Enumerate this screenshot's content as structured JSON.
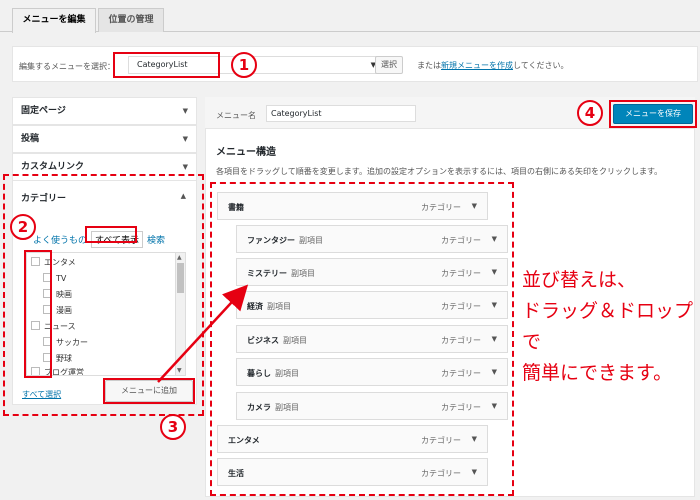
{
  "tabs": [
    {
      "label": "メニューを編集"
    },
    {
      "label": "位置の管理"
    }
  ],
  "manage": {
    "label": "編集するメニューを選択：",
    "selected_menu": "CategoryList",
    "select_button": "選択",
    "or_text": "または",
    "new_menu_link": "新規メニューを作成",
    "tail_text": "してください。"
  },
  "left": {
    "sections": [
      {
        "label": "固定ページ"
      },
      {
        "label": "投稿"
      },
      {
        "label": "カスタムリンク"
      }
    ],
    "category": {
      "title": "カテゴリー",
      "tab_recent": "よく使うもの",
      "tab_all": "すべて表示",
      "tab_search": "検索",
      "items": [
        {
          "label": "エンタメ"
        },
        {
          "label": "TV"
        },
        {
          "label": "映画"
        },
        {
          "label": "漫画"
        },
        {
          "label": "ニュース"
        },
        {
          "label": "サッカー"
        },
        {
          "label": "野球"
        },
        {
          "label": "ブログ運営"
        }
      ],
      "select_all": "すべて選択",
      "add_button": "メニューに追加"
    }
  },
  "right": {
    "menu_name_label": "メニュー名",
    "menu_name_value": "CategoryList",
    "save_button": "メニューを保存",
    "structure_title": "メニュー構造",
    "structure_desc": "各項目をドラッグして順番を変更します。追加の設定オプションを表示するには、項目の右側にある矢印をクリックします。",
    "type_label": "カテゴリー",
    "sub_label": "副項目",
    "items": [
      {
        "title": "書籍"
      },
      {
        "title": "ファンタジー"
      },
      {
        "title": "ミステリー"
      },
      {
        "title": "経済"
      },
      {
        "title": "ビジネス"
      },
      {
        "title": "暮らし"
      },
      {
        "title": "カメラ"
      },
      {
        "title": "エンタメ"
      },
      {
        "title": "生活"
      }
    ]
  },
  "annotations": {
    "num1": "1",
    "num2": "2",
    "num3": "3",
    "num4": "4",
    "note_line1": "並び替えは、",
    "note_line2": "ドラッグ＆ドロップで",
    "note_line3": "簡単にできます。"
  },
  "colors": {
    "annotation_red": "#e60012",
    "primary_blue": "#0085ba",
    "link_blue": "#0073aa"
  }
}
